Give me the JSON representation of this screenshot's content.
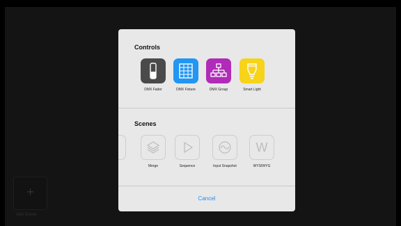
{
  "background": {
    "add_scene": {
      "plus": "+",
      "label": "Add Scene"
    }
  },
  "dialog": {
    "controls": {
      "title": "Controls",
      "items": [
        {
          "label": "DMX Fader",
          "icon": "fader-icon",
          "color": "#4a4a4a"
        },
        {
          "label": "DMX Fixture",
          "icon": "grid-icon",
          "color": "#2196f3"
        },
        {
          "label": "DMX Group",
          "icon": "hierarchy-icon",
          "color": "#b02bb8"
        },
        {
          "label": "Smart Light",
          "icon": "bulb-icon",
          "color": "#f7d31a"
        }
      ]
    },
    "scenes": {
      "title": "Scenes",
      "items": [
        {
          "label": "Merge",
          "icon": "layers-icon"
        },
        {
          "label": "Sequence",
          "icon": "play-icon"
        },
        {
          "label": "Input Snapshot",
          "icon": "wave-icon"
        },
        {
          "label": "WYSIWYG",
          "icon": "w-icon"
        }
      ],
      "wysiwyg_glyph": "W"
    },
    "cancel_label": "Cancel"
  }
}
